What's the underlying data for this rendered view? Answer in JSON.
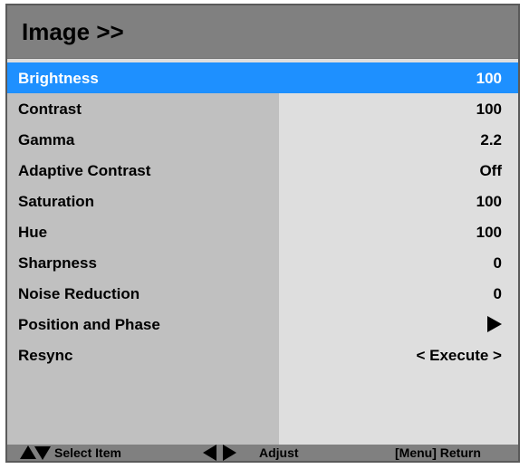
{
  "menu": {
    "title": "Image >>",
    "items": [
      {
        "label": "Brightness",
        "value": "100",
        "selected": true
      },
      {
        "label": "Contrast",
        "value": "100"
      },
      {
        "label": "Gamma",
        "value": "2.2"
      },
      {
        "label": "Adaptive Contrast",
        "value": "Off"
      },
      {
        "label": "Saturation",
        "value": "100"
      },
      {
        "label": "Hue",
        "value": "100"
      },
      {
        "label": "Sharpness",
        "value": "0"
      },
      {
        "label": "Noise Reduction",
        "value": "0"
      },
      {
        "label": "Position and Phase",
        "value_icon": "right-triangle-icon"
      },
      {
        "label": "Resync",
        "value": "< Execute >"
      }
    ]
  },
  "footer": {
    "select_label": "Select Item",
    "adjust_label": "Adjust",
    "return_label": "[Menu] Return"
  },
  "colors": {
    "selected_row": "#1e90ff",
    "header": "#808080",
    "left_column": "#c0c0c0",
    "right_column": "#dedede"
  }
}
